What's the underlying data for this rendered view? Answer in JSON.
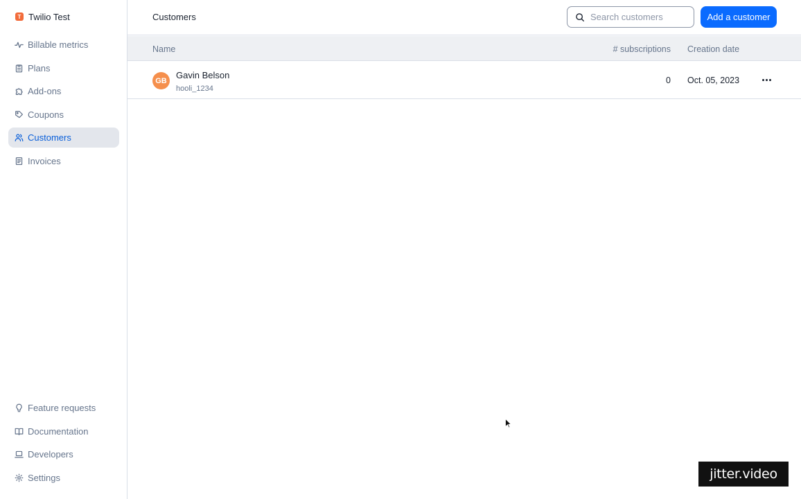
{
  "organization": {
    "badge": "T",
    "name": "Twilio Test",
    "badge_color": "#f26b3a"
  },
  "sidebar": {
    "top_items": [
      {
        "label": "Billable metrics",
        "icon": "pulse-icon"
      },
      {
        "label": "Plans",
        "icon": "clipboard-icon"
      },
      {
        "label": "Add-ons",
        "icon": "puzzle-icon"
      },
      {
        "label": "Coupons",
        "icon": "tag-icon"
      },
      {
        "label": "Customers",
        "icon": "users-icon",
        "active": true
      },
      {
        "label": "Invoices",
        "icon": "receipt-icon"
      }
    ],
    "bottom_items": [
      {
        "label": "Feature requests",
        "icon": "lightbulb-icon"
      },
      {
        "label": "Documentation",
        "icon": "book-icon"
      },
      {
        "label": "Developers",
        "icon": "laptop-icon"
      },
      {
        "label": "Settings",
        "icon": "gear-icon"
      }
    ]
  },
  "header": {
    "title": "Customers",
    "search_placeholder": "Search customers",
    "search_value": "",
    "add_button_label": "Add a customer"
  },
  "table": {
    "columns": [
      "Name",
      "# subscriptions",
      "Creation date"
    ],
    "rows": [
      {
        "initials": "GB",
        "name": "Gavin Belson",
        "external_id": "hooli_1234",
        "subscriptions": "0",
        "creation_date": "Oct. 05, 2023"
      }
    ]
  },
  "watermark": "jitter.video",
  "colors": {
    "accent": "#0a6bff",
    "active_nav": "#0a5fd9",
    "avatar": "#f58f4c"
  }
}
